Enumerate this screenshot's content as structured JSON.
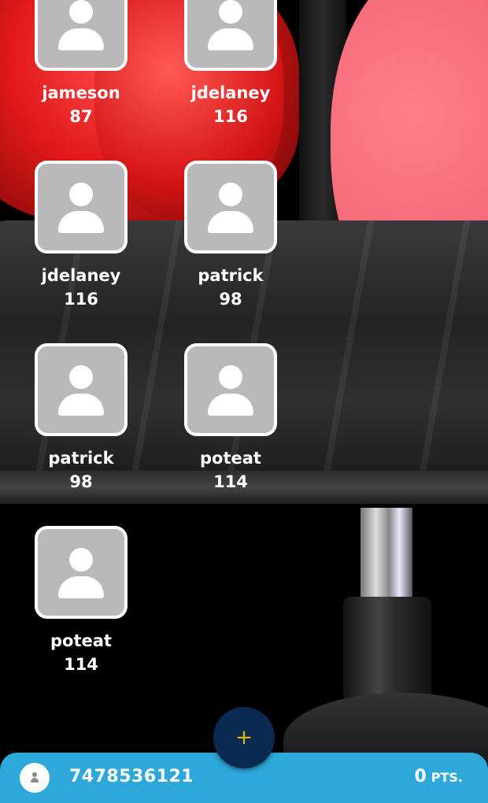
{
  "players": [
    {
      "name": "jameson",
      "score": "87"
    },
    {
      "name": "jdelaney",
      "score": "116"
    },
    {
      "name": "jdelaney",
      "score": "116"
    },
    {
      "name": "patrick",
      "score": "98"
    },
    {
      "name": "patrick",
      "score": "98"
    },
    {
      "name": "poteat",
      "score": "114"
    },
    {
      "name": "poteat",
      "score": "114"
    }
  ],
  "fab": {
    "icon": "plus-icon",
    "symbol": "+",
    "color": "#e6b800"
  },
  "bottom_bar": {
    "phone": "7478536121",
    "points": "0",
    "points_label": "PTS.",
    "background": "#2ea8da"
  }
}
